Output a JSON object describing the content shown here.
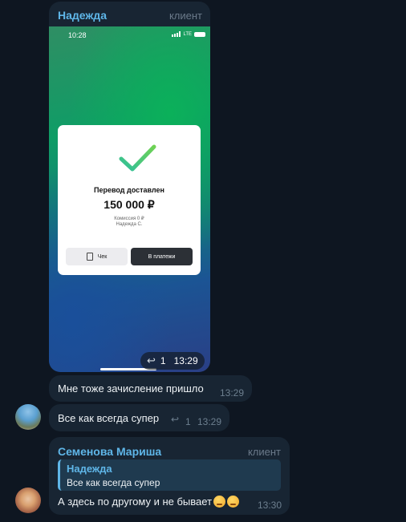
{
  "message1": {
    "sender": "Надежда",
    "role": "клиент",
    "phone": {
      "time": "10:28",
      "status_right": "LTE",
      "card": {
        "title": "Перевод доставлен",
        "amount": "150 000 ₽",
        "commission": "Комиссия 0 ₽",
        "recipient": "Надежда С.",
        "check_button": "Чек",
        "payments_button": "В платежи"
      }
    },
    "replies": "1",
    "time": "13:29"
  },
  "message2": {
    "text": "Мне тоже зачисление пришло",
    "time": "13:29"
  },
  "message3": {
    "text": "Все как всегда супер",
    "replies": "1",
    "time": "13:29"
  },
  "message4": {
    "sender": "Семенова Мариша",
    "role": "клиент",
    "quote": {
      "author": "Надежда",
      "text": "Все как всегда супер"
    },
    "text": "А здесь по другому и не бывает",
    "emojis": [
      "face-icon",
      "face-icon"
    ],
    "time": "13:30"
  },
  "colors": {
    "background": "#0e1621",
    "bubble": "#182533",
    "sender": "#5fb6e8",
    "accent": "#4fd07a"
  }
}
